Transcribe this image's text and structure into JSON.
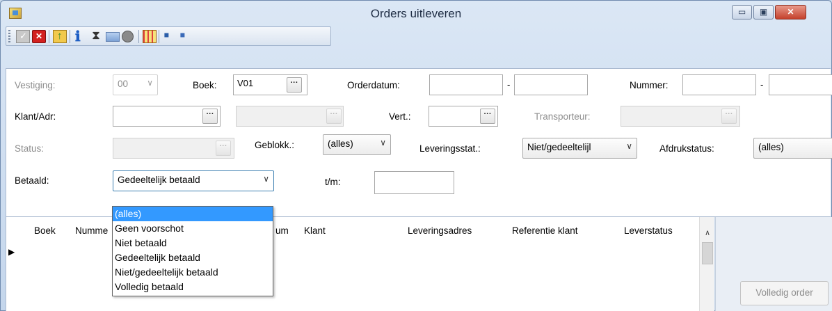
{
  "window": {
    "title": "Orders uitleveren",
    "controls": {
      "minimize": "▭",
      "maximize": "▣",
      "close": "✕"
    }
  },
  "toolbar": {
    "icons": [
      "check-icon",
      "cancel-icon",
      "export-icon",
      "info-icon",
      "hourglass-icon",
      "image-icon",
      "globe-icon",
      "grid-icon",
      "save-icon",
      "save-as-icon"
    ]
  },
  "form": {
    "vestiging": {
      "label": "Vestiging:",
      "value": "00",
      "arrow": "∨"
    },
    "boek": {
      "label": "Boek:",
      "value": "V01",
      "ellipsis": "···"
    },
    "orderdatum": {
      "label": "Orderdatum:",
      "from": "",
      "to": "",
      "separator": "-"
    },
    "nummer": {
      "label": "Nummer:",
      "from": "",
      "to": "",
      "separator": "-"
    },
    "klant_adr": {
      "label": "Klant/Adr:",
      "value": "",
      "value2": "",
      "ellipsis": "···"
    },
    "vert": {
      "label": "Vert.:",
      "value": "",
      "ellipsis": "···"
    },
    "transporteur": {
      "label": "Transporteur:",
      "value": "",
      "ellipsis": "···"
    },
    "status": {
      "label": "Status:",
      "value": "",
      "ellipsis": "···"
    },
    "geblokk": {
      "label": "Geblokk.:",
      "value": "(alles)",
      "arrow": "∨"
    },
    "leveringsstat": {
      "label": "Leveringsstat.:",
      "value": "Niet/gedeeltelijl",
      "arrow": "∨"
    },
    "afdrukstatus": {
      "label": "Afdrukstatus:",
      "value": "(alles)"
    },
    "betaald": {
      "label": "Betaald:",
      "value": "Gedeeltelijk betaald",
      "arrow": "∨"
    },
    "tm": {
      "label": "t/m:",
      "value": ""
    }
  },
  "grid": {
    "columns": [
      "Boek",
      "Numme",
      "um",
      "Klant",
      "Leveringsadres",
      "Referentie klant",
      "Leverstatus"
    ],
    "row_indicator": "▶",
    "scroll_up": "∧"
  },
  "dropdown": {
    "options": [
      "(alles)",
      "Geen voorschot",
      "Niet betaald",
      "Gedeeltelijk betaald",
      "Niet/gedeeltelijk betaald",
      "Volledig betaald"
    ],
    "highlighted_index": 0
  },
  "buttons": {
    "volledig_order": "Volledig order"
  },
  "colors": {
    "highlight": "#3399ff",
    "close_button": "#c4412c",
    "window_frame": "#c4d6ec"
  }
}
